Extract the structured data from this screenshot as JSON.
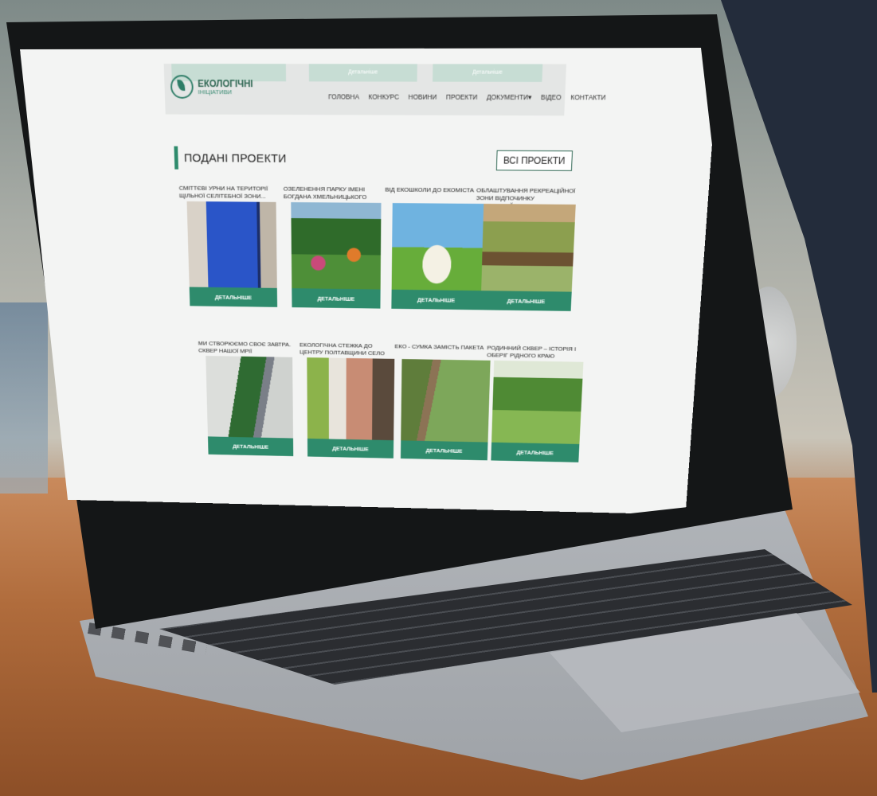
{
  "site": {
    "logo": {
      "title": "ЕКОЛОГІЧНІ",
      "subtitle": "ІНІЦІАТИВИ"
    },
    "header_tabs": [
      "",
      "Детальніше",
      "Детальніше"
    ],
    "nav": [
      "ГОЛОВНА",
      "КОНКУРС",
      "НОВИНИ",
      "ПРОЕКТИ",
      "ДОКУМЕНТИ▾",
      "ВІДЕО",
      "КОНТАКТИ"
    ]
  },
  "section": {
    "title": "ПОДАНІ ПРОЕКТИ",
    "all_button": "ВСІ ПРОЕКТИ"
  },
  "projects": [
    {
      "title": "СМІТТЄВІ УРНИ НА ТЕРИТОРІЇ ЩІЛЬНОЇ СЕЛІТЕБНОЇ ЗОНИ...",
      "button": "ДЕТАЛЬНІШЕ",
      "image": "blue-bin-photo"
    },
    {
      "title": "ОЗЕЛЕНЕННЯ ПАРКУ ІМЕНІ БОГДАНА ХМЕЛЬНИЦЬКОГО",
      "button": "ДЕТАЛЬНІШЕ",
      "image": "park-garden-photo"
    },
    {
      "title": "ВІД ЕКОШКОЛИ ДО ЕКОМІСТА",
      "button": "ДЕТАЛЬНІШЕ",
      "image": "open-book-photo"
    },
    {
      "title": "ОБЛАШТУВАННЯ РЕКРЕАЦІЙНОЇ ЗОНИ ВІДПОЧИНКУ «ЗАТИШНИЙ...",
      "button": "ДЕТАЛЬНІШЕ",
      "image": "picnic-table-photo"
    },
    {
      "title": "МИ СТВОРЮЄМО СВОЄ ЗАВТРА. СКВЕР НАШОЇ МРІЇ",
      "button": "ДЕТАЛЬНІШЕ",
      "image": "square-render-photo"
    },
    {
      "title": "ЕКОЛОГІЧНА СТЕЖКА ДО ЦЕНТРУ ПОЛТАВЩИНИ СЕЛО КРАСНОГОРІВКА...",
      "button": "ДЕТАЛЬНІШЕ",
      "image": "woman-map-photo"
    },
    {
      "title": "ЕКО - СУМКА ЗАМІСТЬ ПАКЕТА",
      "button": "ДЕТАЛЬНІШЕ",
      "image": "forest-photo"
    },
    {
      "title": "РОДИННИЙ СКВЕР – ІСТОРІЯ І ОБЕРІГ РІДНОГО КРАЮ",
      "button": "ДЕТАЛЬНІШЕ",
      "image": "meadow-photo"
    }
  ],
  "colors": {
    "accent": "#2e8b6c",
    "panel": "#232c3b"
  }
}
